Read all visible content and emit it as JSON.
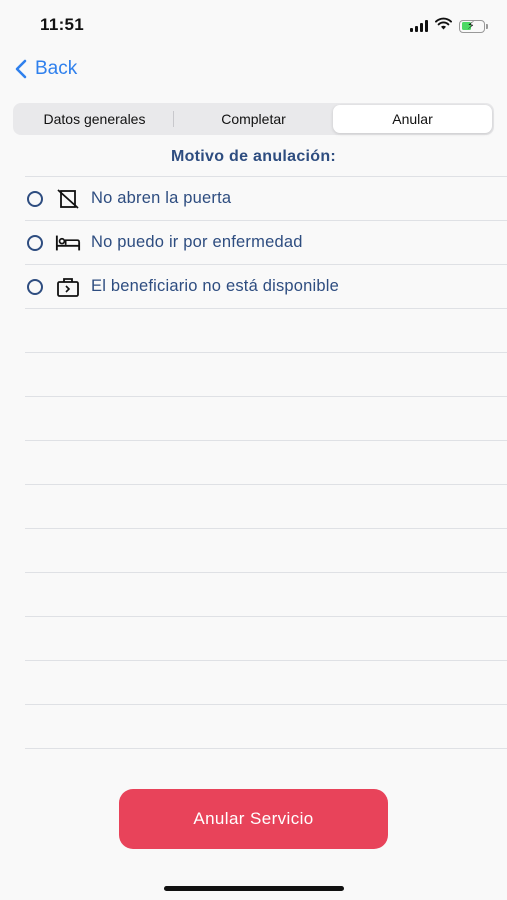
{
  "status_bar": {
    "time": "11:51"
  },
  "nav": {
    "back_label": "Back"
  },
  "segments": [
    {
      "label": "Datos generales"
    },
    {
      "label": "Completar"
    },
    {
      "label": "Anular"
    }
  ],
  "section_title": "Motivo de anulación:",
  "reasons": [
    {
      "label": "No abren la puerta",
      "icon": "door-closed-icon"
    },
    {
      "label": "No puedo ir por enfermedad",
      "icon": "bed-icon"
    },
    {
      "label": "El beneficiario no está disponible",
      "icon": "suitcase-icon"
    }
  ],
  "primary_action": {
    "label": "Anular Servicio"
  },
  "colors": {
    "accent": "#2f80ed",
    "text_primary": "#2e4d80",
    "danger": "#e8435a",
    "background": "#f9f9f9"
  }
}
